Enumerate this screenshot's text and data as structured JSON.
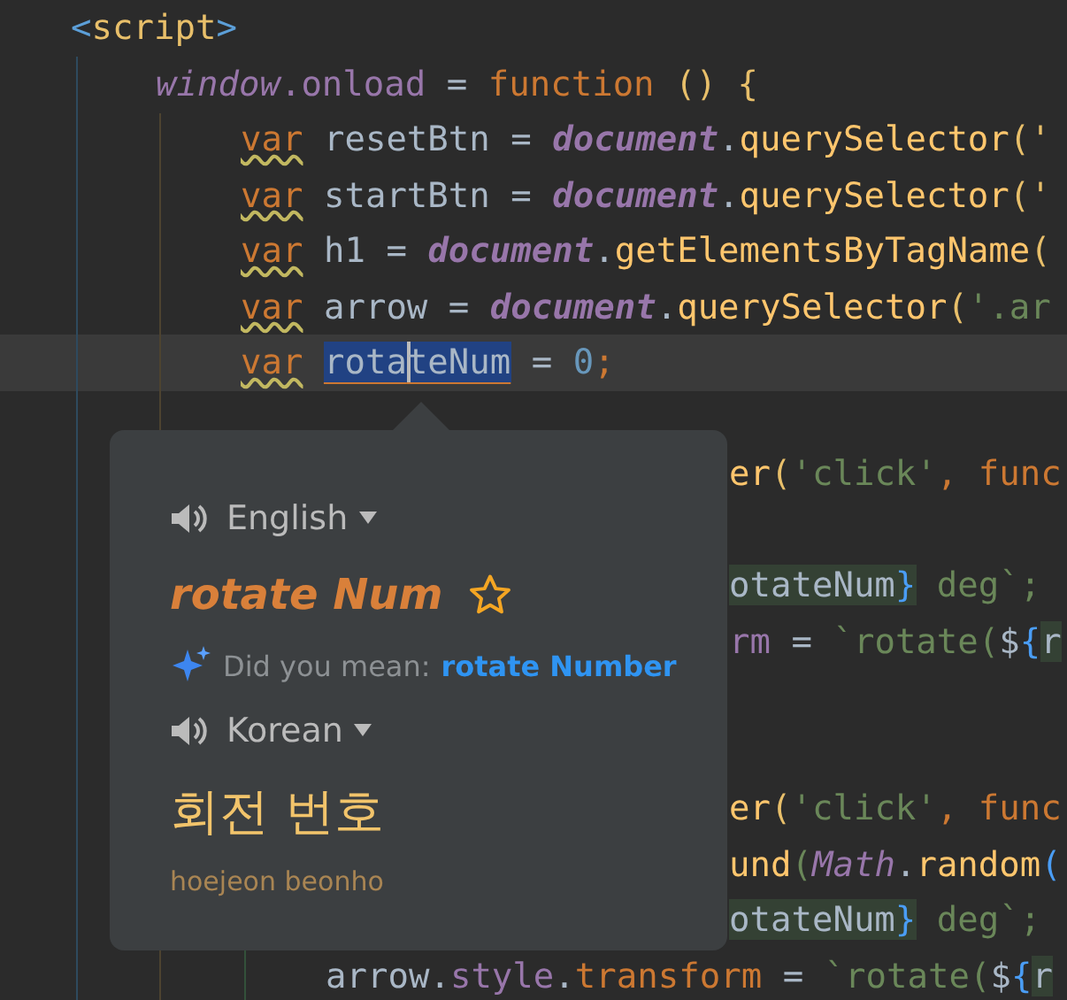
{
  "editor": {
    "lines": [
      {
        "kind": "code",
        "tokens": [
          {
            "text": "<",
            "kind": "tagmark"
          },
          {
            "text": "script",
            "kind": "tag"
          },
          {
            "text": ">",
            "kind": "tagmark"
          }
        ],
        "children": [
          {
            "kind": "code",
            "tokens": [
              {
                "text": "window",
                "kind": "global"
              },
              {
                "text": ".onload",
                "kind": "field"
              },
              {
                "text": " = ",
                "kind": "plain"
              },
              {
                "text": "function",
                "kind": "keyword"
              },
              {
                "text": " () {",
                "kind": "paren"
              }
            ],
            "children": [
              {
                "kind": "code",
                "tokens": [
                  {
                    "text": "var",
                    "kind": "keyword",
                    "warning": true
                  },
                  {
                    "text": " resetBtn = ",
                    "kind": "plain"
                  },
                  {
                    "text": "document",
                    "kind": "global-bold"
                  },
                  {
                    "text": ".",
                    "kind": "plain"
                  },
                  {
                    "text": "querySelector",
                    "kind": "func"
                  },
                  {
                    "text": "('",
                    "kind": "paren"
                  }
                ]
              },
              {
                "kind": "code",
                "tokens": [
                  {
                    "text": "var",
                    "kind": "keyword",
                    "warning": true
                  },
                  {
                    "text": " startBtn = ",
                    "kind": "plain"
                  },
                  {
                    "text": "document",
                    "kind": "global-bold"
                  },
                  {
                    "text": ".",
                    "kind": "plain"
                  },
                  {
                    "text": "querySelector",
                    "kind": "func"
                  },
                  {
                    "text": "('",
                    "kind": "paren"
                  }
                ]
              },
              {
                "kind": "code",
                "tokens": [
                  {
                    "text": "var",
                    "kind": "keyword",
                    "warning": true
                  },
                  {
                    "text": " h1 = ",
                    "kind": "plain"
                  },
                  {
                    "text": "document",
                    "kind": "global-bold"
                  },
                  {
                    "text": ".",
                    "kind": "plain"
                  },
                  {
                    "text": "getElementsByTagName",
                    "kind": "func"
                  },
                  {
                    "text": "(",
                    "kind": "paren"
                  }
                ]
              },
              {
                "kind": "code",
                "tokens": [
                  {
                    "text": "var",
                    "kind": "keyword",
                    "warning": true
                  },
                  {
                    "text": " arrow = ",
                    "kind": "plain"
                  },
                  {
                    "text": "document",
                    "kind": "global-bold"
                  },
                  {
                    "text": ".",
                    "kind": "plain"
                  },
                  {
                    "text": "querySelector",
                    "kind": "func"
                  },
                  {
                    "text": "(",
                    "kind": "paren"
                  },
                  {
                    "text": "'.ar",
                    "kind": "string"
                  }
                ]
              },
              {
                "kind": "code",
                "current": true,
                "tokens": [
                  {
                    "text": "var",
                    "kind": "keyword",
                    "warning": true
                  },
                  {
                    "text": "rota",
                    "kind": "plain",
                    "selected": true,
                    "spaced": true
                  },
                  {
                    "text": "teNum",
                    "kind": "plain",
                    "selected": true,
                    "caret": true
                  },
                  {
                    "text": " = ",
                    "kind": "plain"
                  },
                  {
                    "text": "0",
                    "kind": "number"
                  },
                  {
                    "text": ";",
                    "kind": "keyword"
                  }
                ]
              },
              {
                "kind": "empty"
              },
              {
                "kind": "partial",
                "tokens": [
                  {
                    "text": "er",
                    "kind": "func"
                  },
                  {
                    "text": "(",
                    "kind": "paren"
                  },
                  {
                    "text": "'click'",
                    "kind": "string"
                  },
                  {
                    "text": ", ",
                    "kind": "keyword"
                  },
                  {
                    "text": "func",
                    "kind": "keyword"
                  }
                ],
                "children": [
                  {
                    "kind": "empty"
                  },
                  {
                    "kind": "partial",
                    "tokens": [
                      {
                        "text": "otateNum",
                        "kind": "plain",
                        "highlight": true
                      },
                      {
                        "text": "}",
                        "kind": "brace",
                        "highlight": true
                      },
                      {
                        "text": " deg`;",
                        "kind": "string"
                      }
                    ]
                  },
                  {
                    "kind": "partial",
                    "tokens": [
                      {
                        "text": "rm",
                        "kind": "field"
                      },
                      {
                        "text": " = ",
                        "kind": "plain"
                      },
                      {
                        "text": "`rotate(",
                        "kind": "string"
                      },
                      {
                        "text": "$",
                        "kind": "plain"
                      },
                      {
                        "text": "{",
                        "kind": "brace"
                      },
                      {
                        "text": "r",
                        "kind": "plain",
                        "highlight": true
                      }
                    ]
                  }
                ]
              },
              {
                "kind": "empty"
              },
              {
                "kind": "empty"
              },
              {
                "kind": "partial",
                "tokens": [
                  {
                    "text": "er",
                    "kind": "func"
                  },
                  {
                    "text": "(",
                    "kind": "paren"
                  },
                  {
                    "text": "'click'",
                    "kind": "string"
                  },
                  {
                    "text": ", ",
                    "kind": "keyword"
                  },
                  {
                    "text": "func",
                    "kind": "keyword"
                  }
                ],
                "children": [
                  {
                    "kind": "partial",
                    "tokens": [
                      {
                        "text": "und",
                        "kind": "func"
                      },
                      {
                        "text": "(",
                        "kind": "string"
                      },
                      {
                        "text": "Math",
                        "kind": "global"
                      },
                      {
                        "text": ".",
                        "kind": "plain"
                      },
                      {
                        "text": "random",
                        "kind": "func"
                      },
                      {
                        "text": "(",
                        "kind": "brace"
                      }
                    ]
                  },
                  {
                    "kind": "partial",
                    "tokens": [
                      {
                        "text": "otateNum",
                        "kind": "plain",
                        "highlight": true
                      },
                      {
                        "text": "}",
                        "kind": "brace",
                        "highlight": true
                      },
                      {
                        "text": " deg`;",
                        "kind": "string"
                      }
                    ]
                  },
                  {
                    "kind": "code",
                    "tokens": [
                      {
                        "text": "arrow",
                        "kind": "plain"
                      },
                      {
                        "text": ".",
                        "kind": "plain"
                      },
                      {
                        "text": "style",
                        "kind": "field"
                      },
                      {
                        "text": ".",
                        "kind": "plain"
                      },
                      {
                        "text": "transform",
                        "kind": "keyword"
                      },
                      {
                        "text": " = ",
                        "kind": "plain"
                      },
                      {
                        "text": "`rotate(",
                        "kind": "string"
                      },
                      {
                        "text": "$",
                        "kind": "plain"
                      },
                      {
                        "text": "{",
                        "kind": "brace"
                      },
                      {
                        "text": "r",
                        "kind": "plain",
                        "highlight": true
                      }
                    ]
                  }
                ]
              }
            ]
          }
        ]
      }
    ]
  },
  "translation_popup": {
    "source_language": "English",
    "source_text": "rotate Num",
    "favorite": false,
    "suggestion_label": "Did you mean:",
    "suggestion": "rotate Number",
    "target_language": "Korean",
    "translation": "회전 번호",
    "romanization": "hoejeon beonho"
  }
}
